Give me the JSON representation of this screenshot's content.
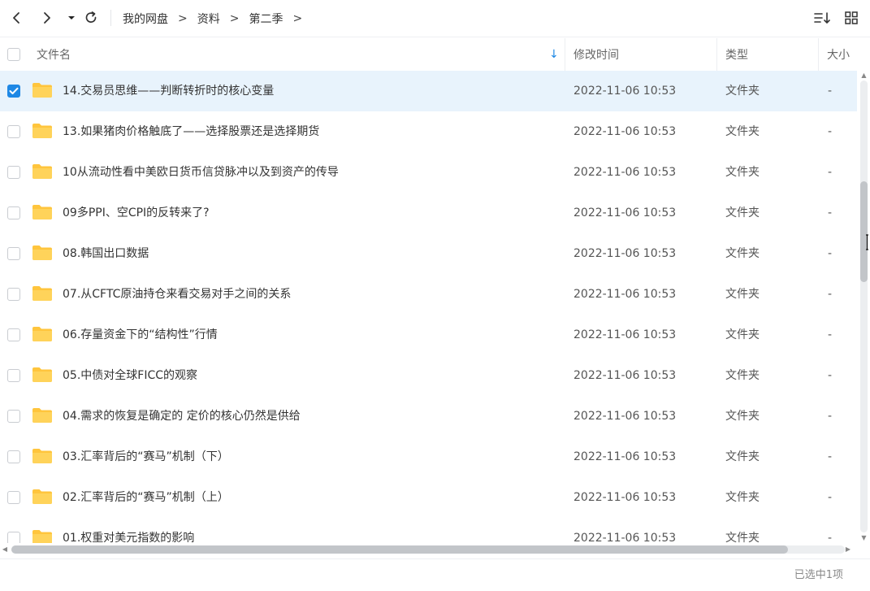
{
  "toolbar": {
    "back_icon": "chevron-left-icon",
    "forward_icon": "chevron-right-icon",
    "history_icon": "caret-down-icon",
    "refresh_icon": "refresh-icon",
    "sort_icon": "sort-list-icon",
    "grid_icon": "grid-view-icon"
  },
  "breadcrumb": [
    {
      "label": "我的网盘"
    },
    {
      "label": "资料"
    },
    {
      "label": "第二季"
    }
  ],
  "breadcrumb_separator": ">",
  "columns": {
    "name": "文件名",
    "modified": "修改时间",
    "type": "类型",
    "size": "大小",
    "sort_indicator": "↓"
  },
  "files": [
    {
      "name": "14.交易员思维——判断转折时的核心变量",
      "modified": "2022-11-06 10:53",
      "type": "文件夹",
      "size": "-",
      "selected": true
    },
    {
      "name": "13.如果猪肉价格触底了——选择股票还是选择期货",
      "modified": "2022-11-06 10:53",
      "type": "文件夹",
      "size": "-",
      "selected": false
    },
    {
      "name": "10从流动性看中美欧日货币信贷脉冲以及到资产的传导",
      "modified": "2022-11-06 10:53",
      "type": "文件夹",
      "size": "-",
      "selected": false
    },
    {
      "name": "09多PPI、空CPI的反转来了?",
      "modified": "2022-11-06 10:53",
      "type": "文件夹",
      "size": "-",
      "selected": false
    },
    {
      "name": "08.韩国出口数据",
      "modified": "2022-11-06 10:53",
      "type": "文件夹",
      "size": "-",
      "selected": false
    },
    {
      "name": "07.从CFTC原油持仓来看交易对手之间的关系",
      "modified": "2022-11-06 10:53",
      "type": "文件夹",
      "size": "-",
      "selected": false
    },
    {
      "name": "06.存量资金下的“结构性”行情",
      "modified": "2022-11-06 10:53",
      "type": "文件夹",
      "size": "-",
      "selected": false
    },
    {
      "name": "05.中债对全球FICC的观察",
      "modified": "2022-11-06 10:53",
      "type": "文件夹",
      "size": "-",
      "selected": false
    },
    {
      "name": "04.需求的恢复是确定的 定价的核心仍然是供给",
      "modified": "2022-11-06 10:53",
      "type": "文件夹",
      "size": "-",
      "selected": false
    },
    {
      "name": "03.汇率背后的“赛马”机制（下）",
      "modified": "2022-11-06 10:53",
      "type": "文件夹",
      "size": "-",
      "selected": false
    },
    {
      "name": "02.汇率背后的“赛马”机制（上）",
      "modified": "2022-11-06 10:53",
      "type": "文件夹",
      "size": "-",
      "selected": false
    },
    {
      "name": "01.权重对美元指数的影响",
      "modified": "2022-11-06 10:53",
      "type": "文件夹",
      "size": "-",
      "selected": false
    }
  ],
  "folder_icon": "folder-icon",
  "folder_color": "#FFC53D",
  "accent_color": "#1E88E5",
  "selected_row_color": "#E8F3FC",
  "status": {
    "selection_text": "已选中1项"
  }
}
